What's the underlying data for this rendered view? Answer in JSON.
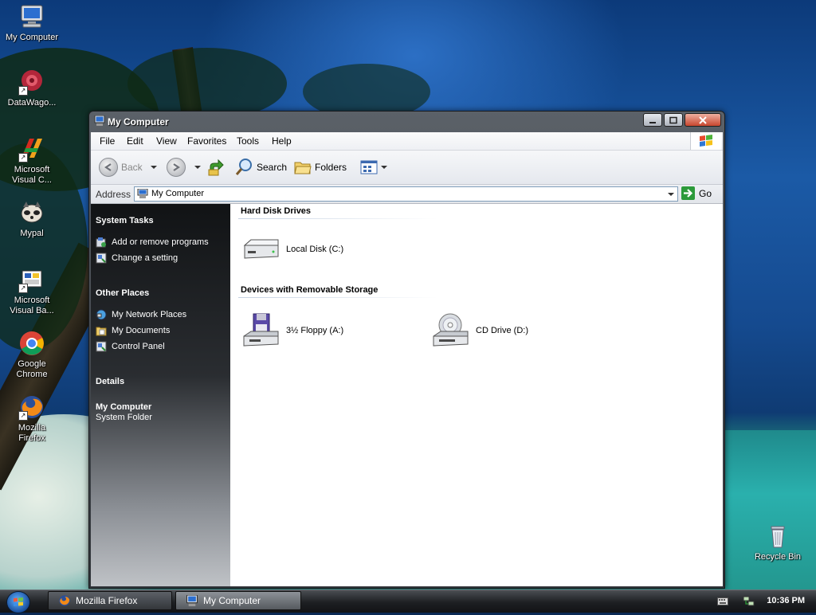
{
  "desktop": {
    "icons": [
      {
        "label": "My Computer"
      },
      {
        "label": "DataWago..."
      },
      {
        "label": "Microsoft Visual C..."
      },
      {
        "label": "Mypal"
      },
      {
        "label": "Microsoft Visual Ba..."
      },
      {
        "label": "Google Chrome"
      },
      {
        "label": "Mozilla Firefox"
      },
      {
        "label": "Recycle Bin"
      }
    ]
  },
  "window": {
    "title": "My Computer",
    "menu": [
      "File",
      "Edit",
      "View",
      "Favorites",
      "Tools",
      "Help"
    ],
    "toolbar": {
      "back": "Back",
      "search": "Search",
      "folders": "Folders"
    },
    "address": {
      "label": "Address",
      "value": "My Computer",
      "go": "Go"
    },
    "left_pane": {
      "system_tasks": {
        "title": "System Tasks",
        "items": [
          "Add or remove programs",
          "Change a setting"
        ]
      },
      "other_places": {
        "title": "Other Places",
        "items": [
          "My Network Places",
          "My Documents",
          "Control Panel"
        ]
      },
      "details": {
        "title": "Details",
        "name": "My Computer",
        "type": "System Folder"
      }
    },
    "content": {
      "groups": [
        {
          "title": "Hard Disk Drives",
          "items": [
            "Local Disk (C:)"
          ]
        },
        {
          "title": "Devices with Removable Storage",
          "items": [
            "3½ Floppy (A:)",
            "CD Drive (D:)"
          ]
        }
      ]
    }
  },
  "taskbar": {
    "buttons": [
      "Mozilla Firefox",
      "My Computer"
    ],
    "clock": "10:36 PM"
  }
}
